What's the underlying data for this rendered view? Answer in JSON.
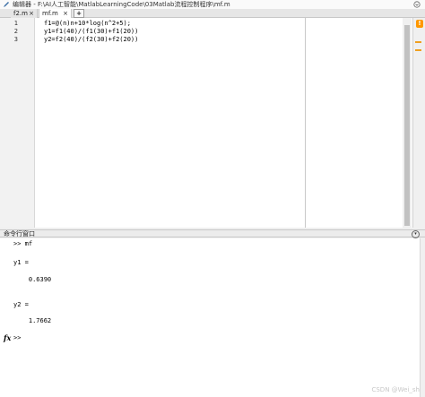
{
  "window": {
    "title": "编辑器 - F:\\AI人工智能\\MatlabLearningCode\\03Matlab流程控制程序\\mf.m"
  },
  "tabs": [
    {
      "label": "f2.m",
      "close": "×",
      "active": false
    },
    {
      "label": "mf.m",
      "close": "×",
      "active": true
    }
  ],
  "add_tab": "+",
  "editor": {
    "line_numbers": [
      "1",
      "2",
      "3"
    ],
    "lines": [
      "f1=@(n)n+10*log(n^2+5);",
      "y1=f1(40)/(f1(30)+f1(20))",
      "y2=f2(40)/(f2(30)+f2(20))"
    ]
  },
  "indicator": {
    "warning_icon": "warning-square-icon",
    "warning_color": "#ff9800"
  },
  "command_window": {
    "title": "命令行窗口",
    "lines": [
      ">> mf",
      "",
      "y1 =",
      "",
      "    0.6390",
      "",
      "",
      "y2 =",
      "",
      "    1.7662"
    ],
    "prompt": ">>",
    "fx_label": "fx"
  },
  "watermark": "CSDN @Wei_sh"
}
